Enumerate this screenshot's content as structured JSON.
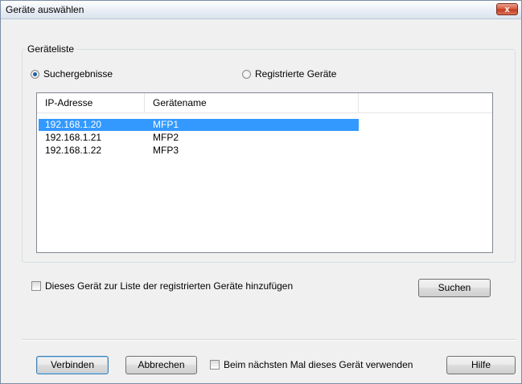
{
  "window": {
    "title": "Geräte auswählen",
    "close_label": "x"
  },
  "group": {
    "legend": "Geräteliste"
  },
  "radios": [
    {
      "label": "Suchergebnisse",
      "checked": true
    },
    {
      "label": "Registrierte Geräte",
      "checked": false
    }
  ],
  "list": {
    "columns": [
      "IP-Adresse",
      "Gerätename"
    ],
    "rows": [
      {
        "ip": "192.168.1.20",
        "name": "MFP1",
        "selected": true
      },
      {
        "ip": "192.168.1.21",
        "name": "MFP2",
        "selected": false
      },
      {
        "ip": "192.168.1.22",
        "name": "MFP3",
        "selected": false
      }
    ]
  },
  "add_to_registered": {
    "label": "Dieses Gerät zur Liste der registrierten Geräte hinzufügen",
    "checked": false
  },
  "buttons": {
    "search": "Suchen",
    "connect": "Verbinden",
    "cancel": "Abbrechen",
    "help": "Hilfe"
  },
  "use_next_time": {
    "label": "Beim nächsten Mal dieses Gerät verwenden",
    "checked": false
  }
}
